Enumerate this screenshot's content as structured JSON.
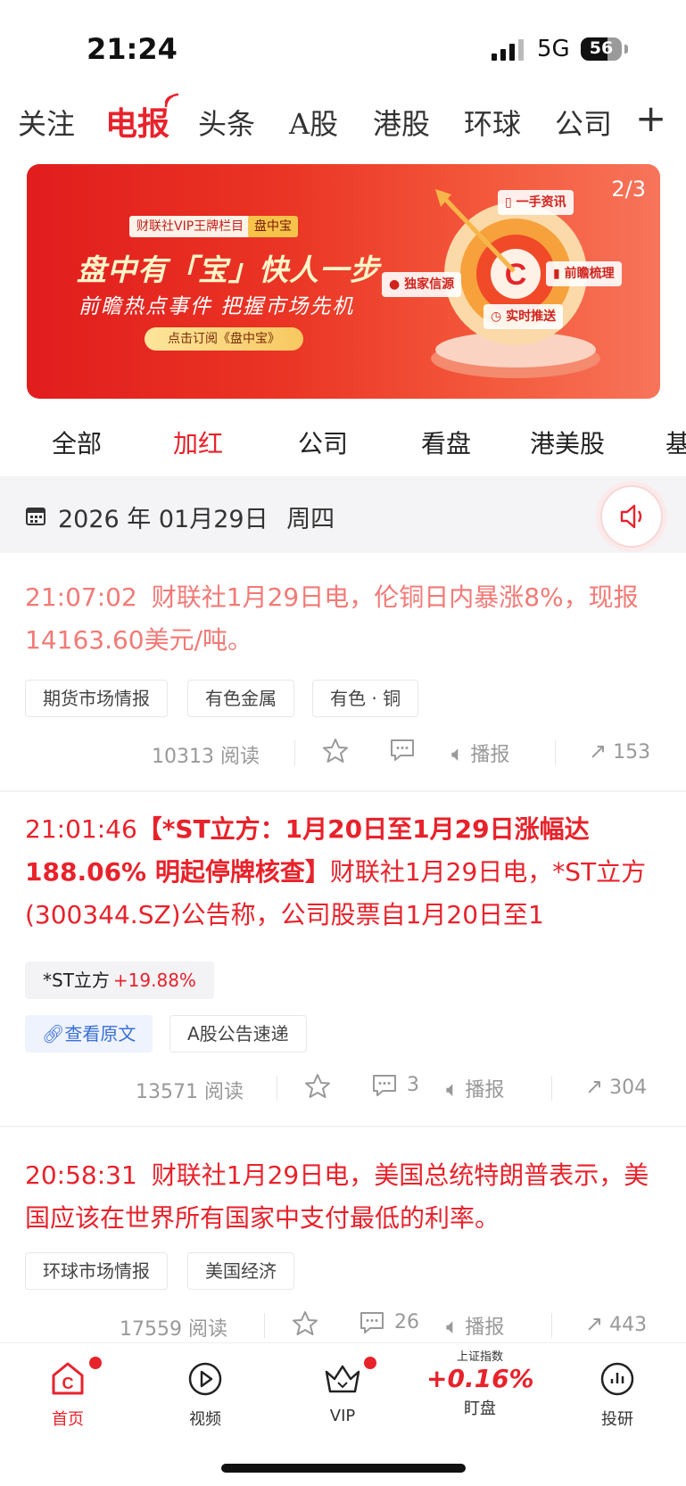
{
  "status_bar": {
    "time": "21:24",
    "network": "5G",
    "battery": "56"
  },
  "top_tabs": [
    "关注",
    "电报",
    "头条",
    "A股",
    "港股",
    "环球",
    "公司"
  ],
  "banner": {
    "page_indicator": "2/3",
    "tag": "财联社VIP王牌栏目",
    "tag_highlight": "盘中宝",
    "title": "盘中有「宝」快人一步",
    "subtitle": "前瞻热点事件 把握市场先机",
    "button": "点击订阅《盘中宝》",
    "features": [
      "一手资讯",
      "独家信源",
      "前瞻梳理",
      "实时推送"
    ]
  },
  "sub_tabs": [
    "全部",
    "加红",
    "公司",
    "看盘",
    "港美股",
    "基"
  ],
  "date_bar": {
    "date": "2026 年 01月29日",
    "weekday": "周四"
  },
  "news": [
    {
      "time": "21:07:02",
      "text": "财联社1月29日电，伦铜日内暴涨8%，现报14163.60美元/吨。",
      "tags": [
        "期货市场情报",
        "有色金属",
        "有色 · 铜"
      ],
      "reads": "10313",
      "read_label": "阅读",
      "comments": "",
      "broadcast": "播报",
      "shares": "153"
    },
    {
      "time": "21:01:46",
      "title": "【*ST立方：1月20日至1月29日涨幅达188.06% 明起停牌核查】",
      "text": "财联社1月29日电，*ST立方(300344.SZ)公告称，公司股票自1月20日至1",
      "stock": {
        "name": "*ST立方",
        "change": "+19.88%"
      },
      "link": "查看原文",
      "tags": [
        "A股公告速递"
      ],
      "reads": "13571",
      "read_label": "阅读",
      "comments": "3",
      "broadcast": "播报",
      "shares": "304"
    },
    {
      "time": "20:58:31",
      "text": "财联社1月29日电，美国总统特朗普表示，美国应该在世界所有国家中支付最低的利率。",
      "tags": [
        "环球市场情报",
        "美国经济"
      ],
      "reads": "17559",
      "read_label": "阅读",
      "comments": "26",
      "broadcast": "播报",
      "shares": "443"
    }
  ],
  "bottom_nav": {
    "items": [
      "首页",
      "视频",
      "VIP",
      "盯盘",
      "投研"
    ],
    "index_label": "上证指数",
    "index_change": "+0.16%"
  },
  "colors": {
    "accent": "#e8222b",
    "link": "#3b6fd8"
  }
}
